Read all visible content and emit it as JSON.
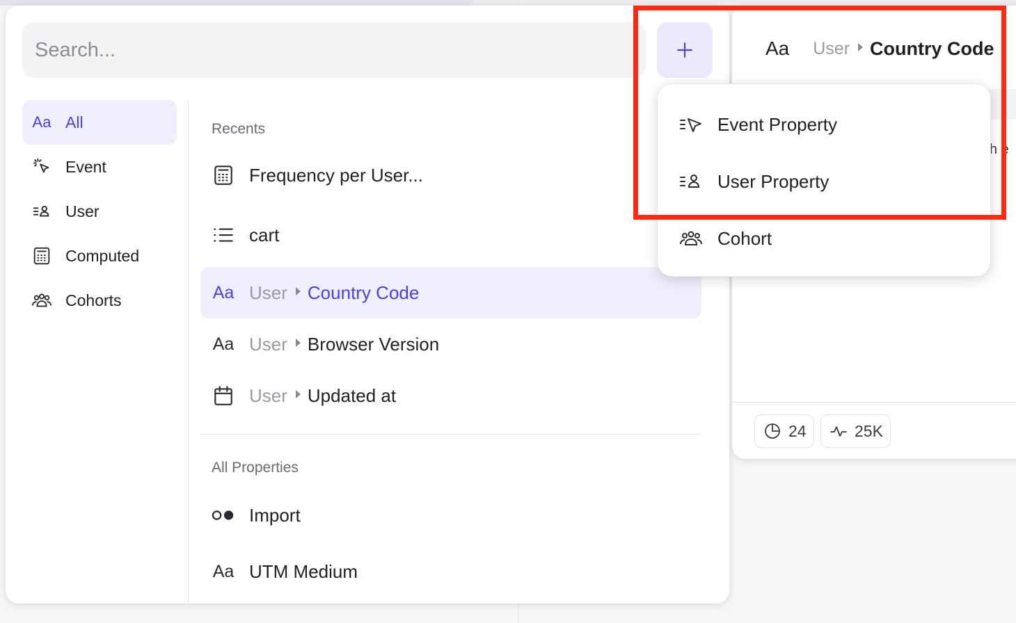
{
  "search": {
    "placeholder": "Search..."
  },
  "add_button": {
    "icon": "plus-icon"
  },
  "sidebar": {
    "items": [
      {
        "icon_text": "Aa",
        "label": "All",
        "active": true
      },
      {
        "icon": "event-cursor-icon",
        "label": "Event"
      },
      {
        "icon": "user-property-icon",
        "label": "User"
      },
      {
        "icon": "calculator-icon",
        "label": "Computed"
      },
      {
        "icon": "cohorts-icon",
        "label": "Cohorts"
      }
    ]
  },
  "recents": {
    "title": "Recents",
    "items": [
      {
        "icon": "calculator-icon",
        "label": "Frequency per User..."
      },
      {
        "icon": "list-icon",
        "label": "cart"
      },
      {
        "icon_text": "Aa",
        "crumb": "User",
        "label": "Country Code",
        "active": true
      },
      {
        "icon_text": "Aa",
        "crumb": "User",
        "label": "Browser Version"
      },
      {
        "icon": "calendar-icon",
        "crumb": "User",
        "label": "Updated at"
      }
    ]
  },
  "all_properties": {
    "title": "All Properties",
    "items": [
      {
        "icon": "toggle-dots-icon",
        "label": "Import"
      },
      {
        "icon_text": "Aa",
        "label": "UTM Medium"
      }
    ]
  },
  "detail": {
    "icon_text": "Aa",
    "crumb": "User",
    "title": "Country Code",
    "partial_text": "h e",
    "stats": [
      {
        "icon": "pie-chart-icon",
        "value": "24"
      },
      {
        "icon": "activity-icon",
        "value": "25K"
      }
    ]
  },
  "menu": {
    "items": [
      {
        "icon": "event-property-icon",
        "label": "Event Property"
      },
      {
        "icon": "user-property-icon",
        "label": "User Property"
      },
      {
        "icon": "cohorts-icon",
        "label": "Cohort"
      }
    ]
  },
  "colors": {
    "accent": "#4b3fe0",
    "accent_bg": "#efeefd",
    "annotation": "#ff2a12"
  }
}
